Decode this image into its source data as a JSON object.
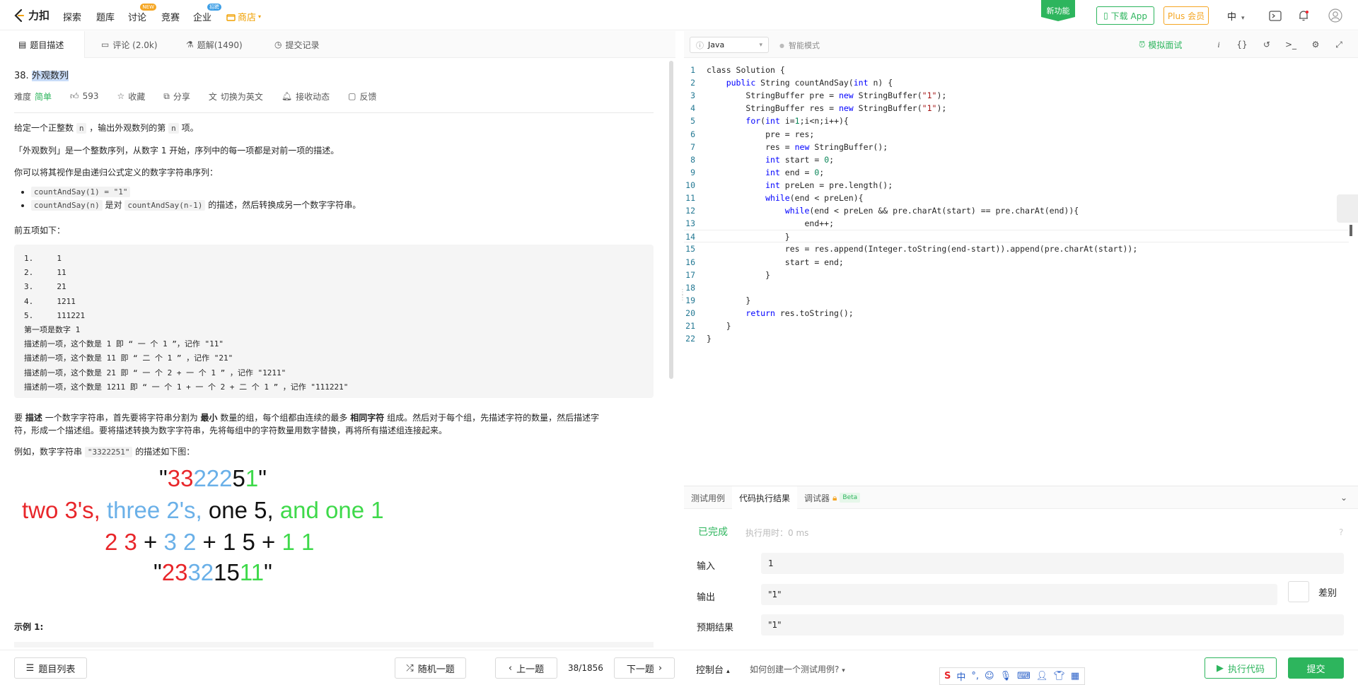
{
  "nav": {
    "logo_text": "力扣",
    "items": [
      "探索",
      "题库",
      "讨论",
      "竞赛",
      "企业"
    ],
    "discuss_badge": "NEW",
    "enterprise_badge": "招聘",
    "store": "商店",
    "new_feature": "新功能",
    "download_app": "下载 App",
    "plus_member": "Plus 会员",
    "lang": "中"
  },
  "tabs": {
    "description": "题目描述",
    "comments": "评论 (2.0k)",
    "solutions": "题解(1490)",
    "submissions": "提交记录"
  },
  "problem": {
    "number": "38.",
    "title": "外观数列",
    "difficulty_label": "难度",
    "difficulty": "简单",
    "likes": "593",
    "favorite": "收藏",
    "share": "分享",
    "switch_english": "切换为英文",
    "subscribe": "接收动态",
    "feedback": "反馈",
    "p1_a": "给定一个正整数",
    "p1_code1": "n",
    "p1_b": "，输出外观数列的第",
    "p1_code2": "n",
    "p1_c": "项。",
    "p2": "「外观数列」是一个整数序列，从数字 1 开始，序列中的每一项都是对前一项的描述。",
    "p3": "你可以将其视作是由递归公式定义的数字字符串序列：",
    "bullet1_code": "countAndSay(1) = \"1\"",
    "bullet2_code1": "countAndSay(n)",
    "bullet2_a": "是对",
    "bullet2_code2": "countAndSay(n-1)",
    "bullet2_b": "的描述，然后转换成另一个数字字符串。",
    "p4": "前五项如下：",
    "pre_lines": [
      "1.     1",
      "2.     11",
      "3.     21",
      "4.     1211",
      "5.     111221",
      "第一项是数字 1",
      "描述前一项，这个数是 1 即 “ 一 个 1 ”，记作 \"11\"",
      "描述前一项，这个数是 11 即 “ 二 个 1 ” ，记作 \"21\"",
      "描述前一项，这个数是 21 即 “ 一 个 2 + 一 个 1 ” ，记作 \"1211\"",
      "描述前一项，这个数是 1211 即 “ 一 个 1 + 一 个 2 + 二 个 1 ” ，记作 \"111221\""
    ],
    "p5_a": "要",
    "p5_b1": "描述",
    "p5_c": "一个数字字符串，首先要将字符串分割为",
    "p5_b2": "最小",
    "p5_d": "数量的组，每个组都由连续的最多",
    "p5_b3": "相同字符",
    "p5_e": "组成。然后对于每个组，先描述字符的数量，然后描述字",
    "p5_f": "符，形成一个描述组。要将描述转换为数字字符串，先将每组中的字符数量用数字替换，再将所有描述组连接起来。",
    "p6_a": "例如，数字字符串",
    "p6_code": "\"3322251\"",
    "p6_b": "的描述如下图：",
    "fig_line1": [
      "\"",
      "33",
      "222",
      "5",
      "1",
      "\""
    ],
    "fig_line2": [
      "two 3's,",
      "three 2's,",
      "one 5,",
      "and one 1"
    ],
    "fig_line3": [
      "2 3",
      "+",
      "3 2",
      "+ 1 5 +",
      "1 1"
    ],
    "fig_line4": [
      "\"",
      "23",
      "32",
      "15",
      "11",
      "\""
    ],
    "example1": "示例 1:"
  },
  "editor": {
    "language": "Java",
    "smart_mode": "智能模式",
    "mock_interview": "模拟面试",
    "code_lines": [
      "class Solution {",
      "    public String countAndSay(int n) {",
      "        StringBuffer pre = new StringBuffer(\"1\");",
      "        StringBuffer res = new StringBuffer(\"1\");",
      "        for(int i=1;i<n;i++){",
      "            pre = res;",
      "            res = new StringBuffer();",
      "            int start = 0;",
      "            int end = 0;",
      "            int preLen = pre.length();",
      "            while(end < preLen){",
      "                while(end < preLen && pre.charAt(start) == pre.charAt(end)){",
      "                    end++;",
      "                }",
      "                res = res.append(Integer.toString(end-start)).append(pre.charAt(start));",
      "                start = end;",
      "            }",
      "",
      "        }",
      "        return res.toString();",
      "    }",
      "}"
    ]
  },
  "console": {
    "tab_testcase": "测试用例",
    "tab_result": "代码执行结果",
    "tab_debugger": "调试器",
    "beta": "Beta",
    "status": "已完成",
    "runtime": "执行用时：0 ms",
    "input_label": "输入",
    "input_value": "1",
    "output_label": "输出",
    "output_value": "\"1\"",
    "diff_label": "差别",
    "expected_label": "预期结果",
    "expected_value": "\"1\""
  },
  "bottom": {
    "problem_list": "题目列表",
    "random": "随机一题",
    "prev": "上一题",
    "page": "38/1856",
    "next": "下一题",
    "console": "控制台",
    "howto": "如何创建一个测试用例?",
    "run": "执行代码",
    "submit": "提交"
  },
  "colors": {
    "brand_green": "#2db55d",
    "plus_orange": "#f5a623",
    "fig_red": "#e8262a",
    "fig_blue": "#6ab0e8",
    "fig_green": "#3ed94a"
  }
}
